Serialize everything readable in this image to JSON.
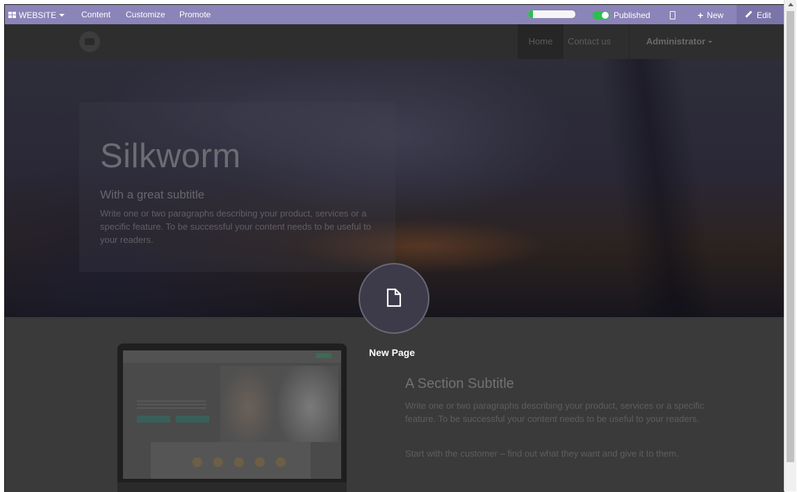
{
  "admin_bar": {
    "website_label": "WEBSITE",
    "content_label": "Content",
    "customize_label": "Customize",
    "promote_label": "Promote",
    "progress_value": 0.1,
    "published_label": "Published",
    "new_label": "New",
    "edit_label": "Edit"
  },
  "site_nav": {
    "home_label": "Home",
    "contact_label": "Contact us",
    "user_label": "Administrator"
  },
  "hero": {
    "title": "Silkworm",
    "subtitle": "With a great subtitle",
    "text": "Write one or two paragraphs describing your product, services or a specific feature. To be successful your content needs to be useful to your readers."
  },
  "section": {
    "title": "A Section Subtitle",
    "paragraph1": "Write one or two paragraphs describing your product, services or a specific feature. To be successful your content needs to be useful to your readers.",
    "paragraph2": "Start with the customer – find out what they want and give it to them."
  },
  "new_page_overlay": {
    "label": "New Page",
    "icon": "file-icon"
  },
  "colors": {
    "admin_bar": "#8b84b8",
    "published_toggle": "#2cbe4e",
    "overlay_backdrop": "#3a3a3a"
  }
}
